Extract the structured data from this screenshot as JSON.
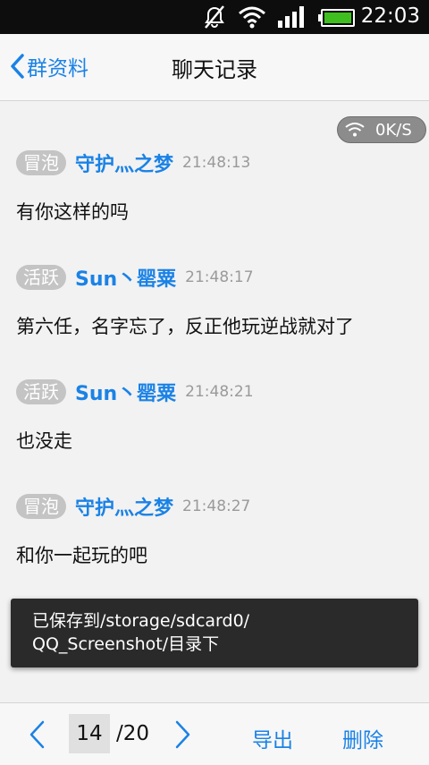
{
  "status_bar": {
    "time": "22:03",
    "icons": [
      "notifications-muted-icon",
      "wifi-icon",
      "signal-icon",
      "battery-icon"
    ]
  },
  "header": {
    "back_label": "群资料",
    "title": "聊天记录"
  },
  "overlay": {
    "network_speed": "0K/S"
  },
  "messages": [
    {
      "badge": "冒泡",
      "nick": "守护灬之梦",
      "time": "21:48:13",
      "text": "有你这样的吗"
    },
    {
      "badge": "活跃",
      "nick": "Sun丶罂粟",
      "time": "21:48:17",
      "text": "第六任，名字忘了，反正他玩逆战就对了"
    },
    {
      "badge": "活跃",
      "nick": "Sun丶罂粟",
      "time": "21:48:21",
      "text": "也没走"
    },
    {
      "badge": "冒泡",
      "nick": "守护灬之梦",
      "time": "21:48:27",
      "text": "和你一起玩的吧"
    }
  ],
  "toast": {
    "line1": "已保存到/storage/sdcard0/",
    "line2": "QQ_Screenshot/目录下"
  },
  "footer": {
    "current_page": "14",
    "total_pages": "/20",
    "export_label": "导出",
    "delete_label": "删除"
  },
  "colors": {
    "accent": "#1a82e6",
    "badge_bg": "#c4c4c4",
    "status_bar_bg": "#0d0d0d"
  }
}
